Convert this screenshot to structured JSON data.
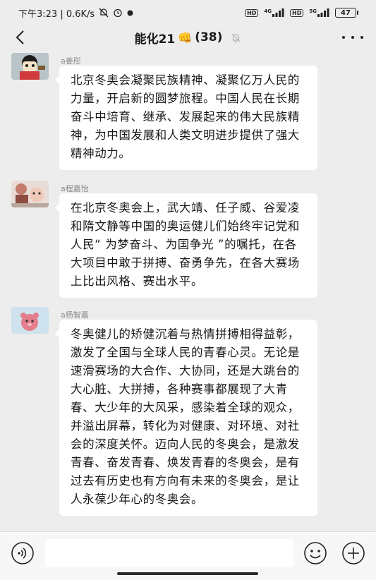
{
  "status_bar": {
    "time_speed": "下午3:23 | 0.6K/s",
    "hd1": "HD",
    "net1": "4G",
    "hd2": "HD",
    "net2": "5G",
    "battery": "47"
  },
  "nav": {
    "title": "能化21",
    "title_emoji": "👊",
    "member_count": "(38)"
  },
  "messages": [
    {
      "sender": "a姜彤",
      "text": "北京冬奥会凝聚民族精神、凝聚亿万人民的力量，开启新的圆梦旅程。中国人民在长期奋斗中培育、继承、发展起来的伟大民族精神，为中国发展和人类文明进步提供了强大精神动力。"
    },
    {
      "sender": "a程嘉怡",
      "text": "在北京冬奥会上，武大靖、任子威、谷爱凌和隋文静等中国的奥运健儿们始终牢记党和人民“ 为梦奋斗、为国争光 ”的嘱托，在各大项目中敢于拼搏、奋勇争先，在各大赛场上比出风格、赛出水平。"
    },
    {
      "sender": "a杨智嘉",
      "text": "冬奥健儿的矫健沉着与热情拼搏相得益彰，激发了全国与全球人民的青春心灵。无论是速滑赛场的大合作、大协同，还是大跳台的大心脏、大拼搏，各种赛事都展现了大青春、大少年的大风采，感染着全球的观众，并溢出屏幕，转化为对健康、对环境、对社会的深度关怀。迈向人民的冬奥会，是激发青春、奋发青春、焕发青春的冬奥会，是有过去有历史也有方向有未来的冬奥会，是让人永葆少年心的冬奥会。"
    }
  ],
  "input": {
    "value": ""
  },
  "icons": {
    "back": "chevron-left-icon",
    "mute": "bell-off-icon",
    "more": "more-dots-icon",
    "voice": "voice-icon",
    "emoji": "emoji-icon",
    "plus": "plus-icon"
  }
}
